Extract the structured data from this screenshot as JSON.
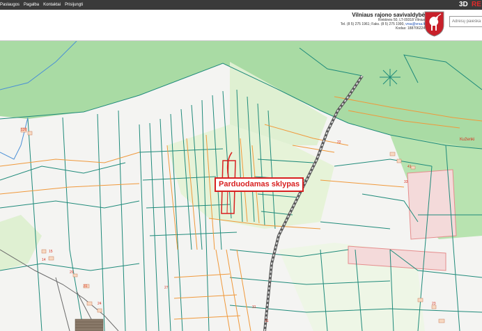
{
  "topnav": {
    "items": [
      {
        "label": "Paslaugos"
      },
      {
        "label": "Pagalba"
      },
      {
        "label": "Kontaktai"
      },
      {
        "label": "Prisijungti"
      }
    ],
    "mode_3d": "3D",
    "mode_re": "RE"
  },
  "municipality": {
    "name": "Vilniaus rajono savivaldybė",
    "address": "Rinktinės 50, LT-09318 Vilnius",
    "phone_prefix": "Tel. (8 5) 275 1961; Faks. (8 5) 275 1990, ",
    "email": "vrsa@vrsa.lt",
    "code": "Kodas: 188706224"
  },
  "search": {
    "placeholder": "Adresų paieška"
  },
  "callout": {
    "label": "Parduodamas sklypas"
  },
  "labels": {
    "parcels": [
      "126",
      "31",
      "22",
      "27",
      "31",
      "29",
      "24",
      "33",
      "15",
      "14",
      "23",
      "41",
      "31"
    ],
    "place": "Kuženki"
  },
  "colors": {
    "forest": "#a9dba4",
    "light_field": "#e6f3d8",
    "cadastre": "#1e8a7a",
    "plan_boundary": "#f0983a",
    "road": "#5a5a5a",
    "highlight": "#d82020",
    "header_bar": "#3a3a3a"
  }
}
